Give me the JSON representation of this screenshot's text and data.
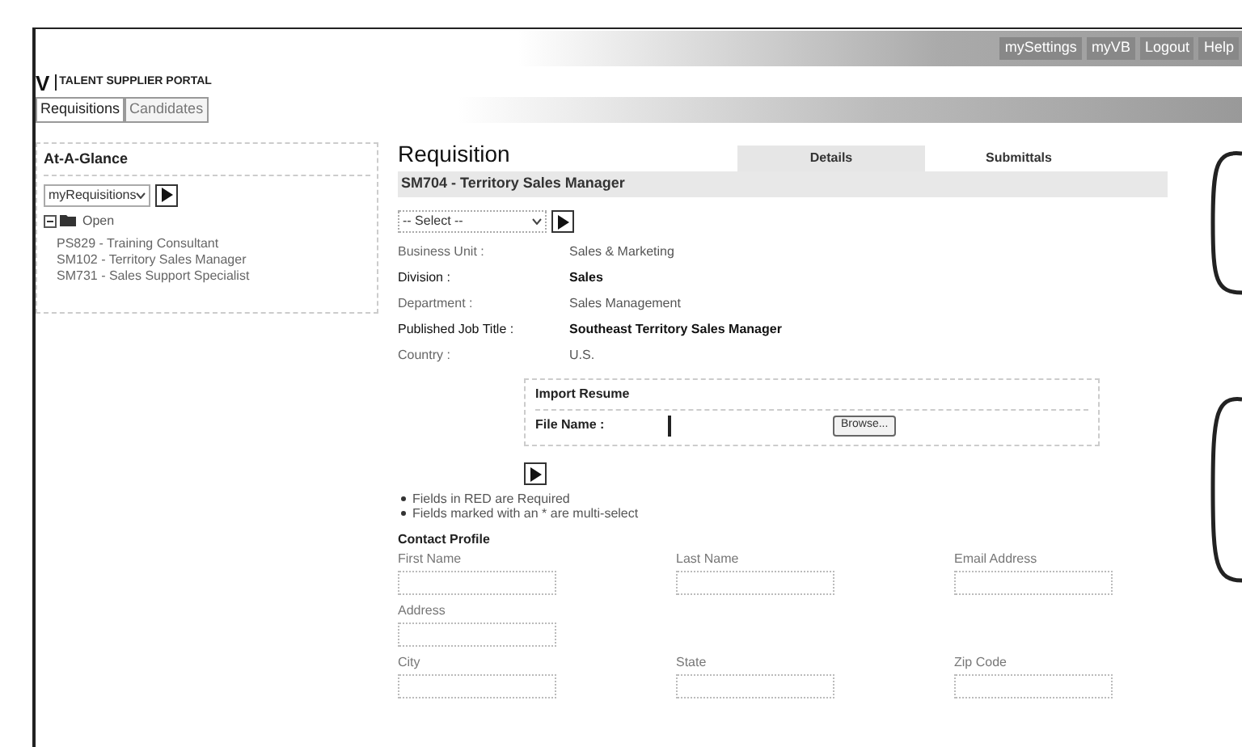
{
  "header": {
    "top_links": [
      "mySettings",
      "myVB",
      "Logout",
      "Help"
    ],
    "logo": "V",
    "portal_title": "TALENT SUPPLIER PORTAL"
  },
  "nav_tabs": [
    {
      "label": "Requisitions",
      "selected": true
    },
    {
      "label": "Candidates",
      "selected": false
    }
  ],
  "at_a_glance": {
    "title": "At-A-Glance",
    "dropdown": "myRequisitions",
    "folder": {
      "label": "Open",
      "expanded": true,
      "children": [
        {
          "label": "PS829 - Training Consultant"
        },
        {
          "label": "SM102 - Territory Sales Manager"
        },
        {
          "label": "SM731 - Sales Support Specialist"
        }
      ]
    }
  },
  "requisition": {
    "title": "Requisition",
    "subtitle": "SM704 - Territory Sales Manager",
    "tabs": [
      {
        "label": "Details",
        "selected": true
      },
      {
        "label": "Submittals",
        "selected": false
      }
    ],
    "action_select": "-- Select --",
    "fields": [
      {
        "label": "Business Unit :",
        "value": "Sales & Marketing",
        "bold": false
      },
      {
        "label": "Division :",
        "value": "Sales",
        "bold": true
      },
      {
        "label": "Department :",
        "value": "Sales Management",
        "bold": false
      },
      {
        "label": "Published Job Title :",
        "value": "Southeast Territory Sales Manager",
        "bold": true
      },
      {
        "label": "Country :",
        "value": "U.S.",
        "bold": false
      }
    ],
    "import_resume": {
      "title": "Import Resume",
      "file_label": "File Name :",
      "browse": "Browse..."
    },
    "notes": [
      "Fields in RED are Required",
      "Fields marked with an * are multi-select"
    ],
    "contact_profile": {
      "title": "Contact Profile",
      "rows": [
        [
          {
            "label": "First Name"
          },
          {
            "label": "Last Name"
          },
          {
            "label": "Email Address"
          }
        ],
        [
          {
            "label": "Address"
          }
        ],
        [
          {
            "label": "City"
          },
          {
            "label": "State"
          },
          {
            "label": "Zip Code"
          }
        ]
      ]
    }
  }
}
